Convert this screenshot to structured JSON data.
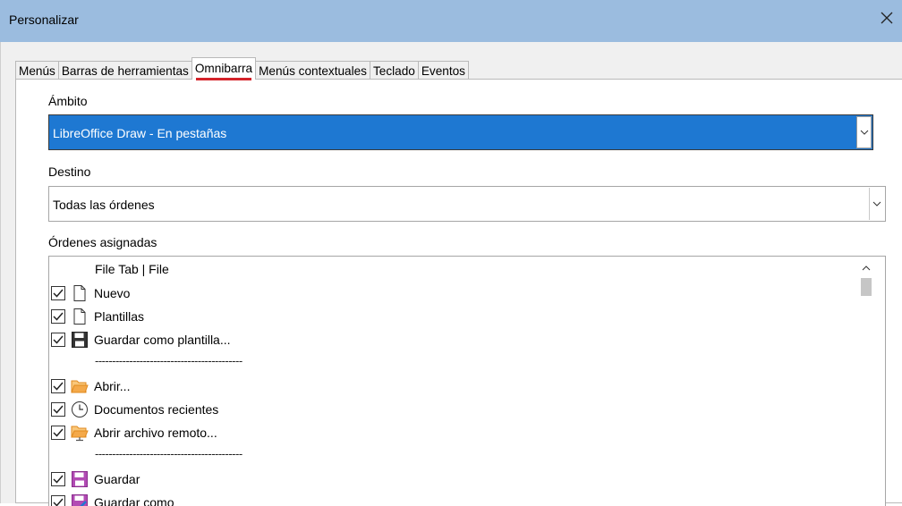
{
  "window": {
    "title": "Personalizar"
  },
  "tabs": [
    {
      "label": "Menús"
    },
    {
      "label": "Barras de herramientas"
    },
    {
      "label": "Omnibarra"
    },
    {
      "label": "Menús contextuales"
    },
    {
      "label": "Teclado"
    },
    {
      "label": "Eventos"
    }
  ],
  "active_tab": "Omnibarra",
  "scope": {
    "label": "Ámbito",
    "value": "LibreOffice Draw -  En pestañas"
  },
  "target": {
    "label": "Destino",
    "value": "Todas las órdenes"
  },
  "assigned": {
    "label": "Órdenes asignadas",
    "group_header": "File Tab | File",
    "separator": "-------------------------------------------",
    "items": [
      {
        "label": "Nuevo",
        "icon": "new-document-icon",
        "checked": true
      },
      {
        "label": "Plantillas",
        "icon": "templates-icon",
        "checked": true
      },
      {
        "label": "Guardar como plantilla...",
        "icon": "save-template-icon",
        "checked": true
      },
      {
        "label": "Abrir...",
        "icon": "open-folder-icon",
        "checked": true
      },
      {
        "label": "Documentos recientes",
        "icon": "clock-icon",
        "checked": true
      },
      {
        "label": "Abrir archivo remoto...",
        "icon": "remote-folder-icon",
        "checked": true
      },
      {
        "label": "Guardar",
        "icon": "save-icon",
        "checked": true
      },
      {
        "label": "Guardar como",
        "icon": "save-as-icon",
        "checked": true
      }
    ]
  },
  "colors": {
    "titlebar": "#9bbcdf",
    "selection": "#1e78d2",
    "tab_underline": "#d4232b",
    "save_purple": "#b24bb4",
    "folder_orange": "#f4a94a"
  }
}
